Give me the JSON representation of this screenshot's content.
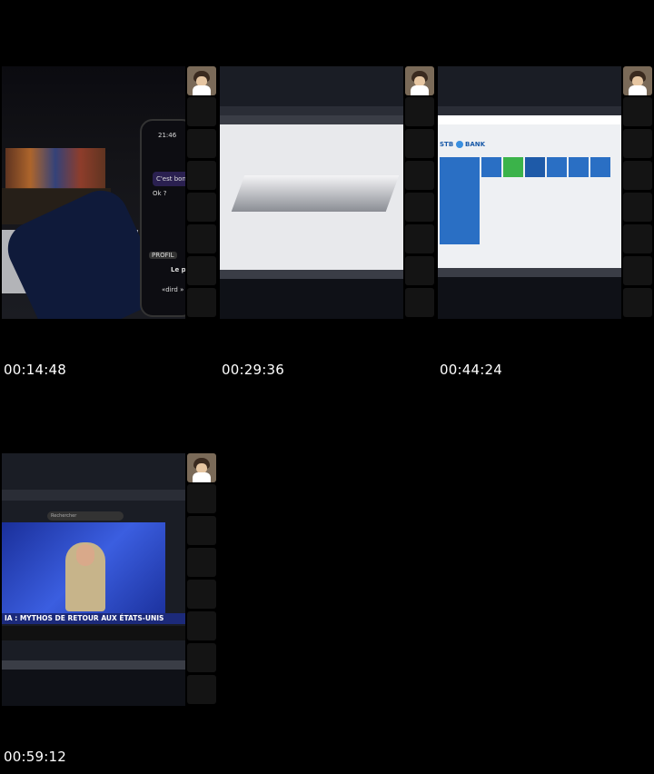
{
  "frames": [
    {
      "timestamp": "00:14:48",
      "phone_time": "21:46",
      "chat_line_1": "C'est bon ?",
      "chat_line_2": "Ok ?",
      "chip_1": "PROFIL",
      "caption": "Le pi",
      "footer": "«dird »"
    },
    {
      "timestamp": "00:29:36"
    },
    {
      "timestamp": "00:44:24",
      "brand_left": "STB",
      "brand_right": "BANK"
    },
    {
      "timestamp": "00:59:12",
      "search_placeholder": "Rechercher",
      "banner_text": "IA : MYTHOS DE RETOUR AUX ÉTATS-UNIS"
    }
  ],
  "colors": {
    "background": "#000000",
    "thumb_strip": "#141414",
    "accent_blue": "#2a6fc4"
  },
  "icons": [
    "avatar-icon"
  ]
}
